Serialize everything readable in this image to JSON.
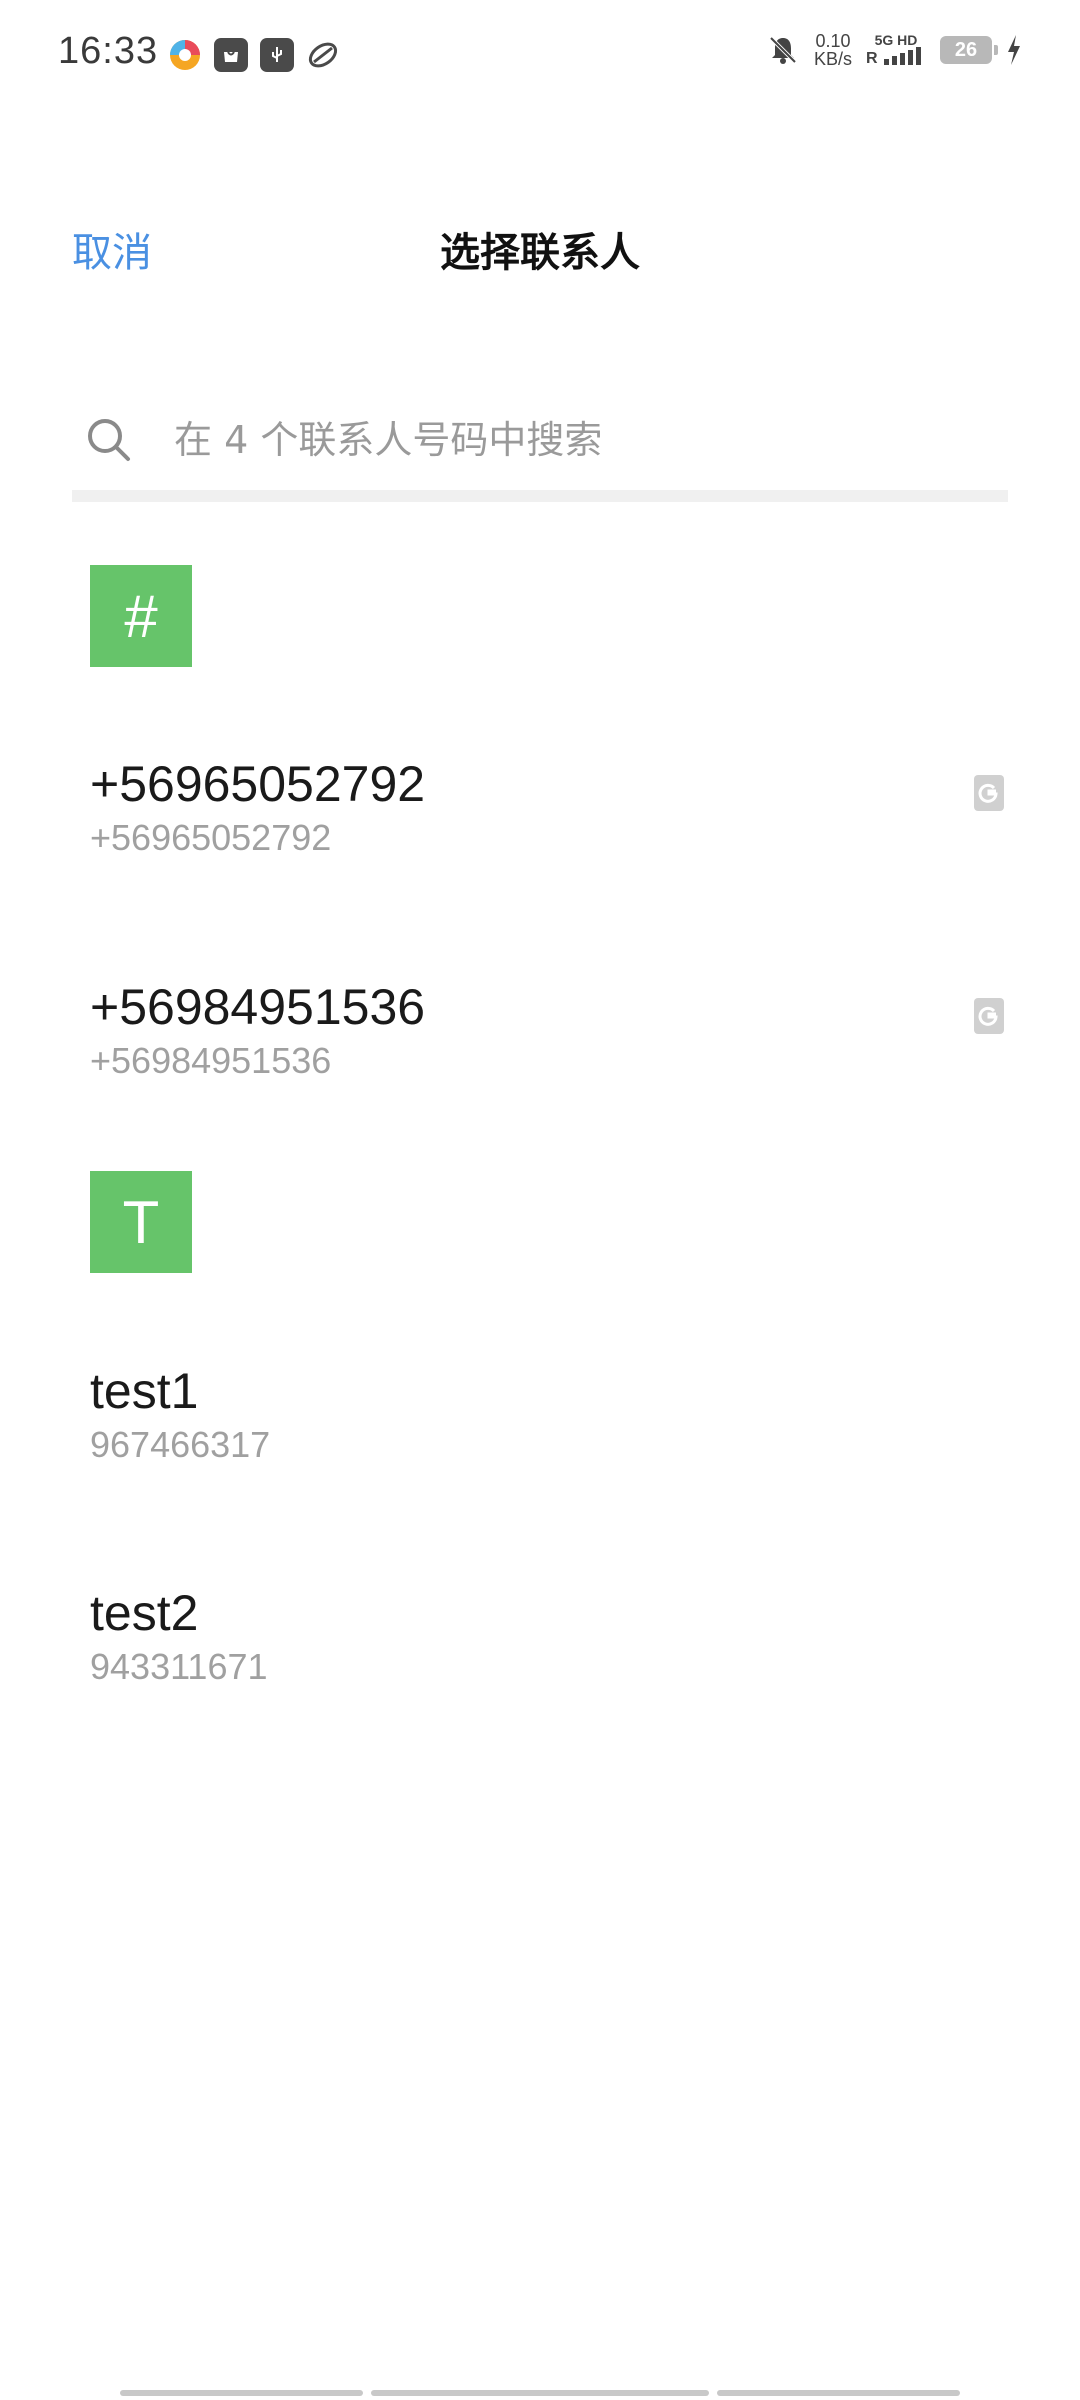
{
  "status_bar": {
    "time": "16:33",
    "net_speed_value": "0.10",
    "net_speed_unit": "KB/s",
    "signal_label": "5G HD",
    "battery": "26"
  },
  "header": {
    "cancel_label": "取消",
    "title": "选择联系人"
  },
  "search": {
    "placeholder": "在 4 个联系人号码中搜索"
  },
  "sections": [
    {
      "letter": "#",
      "contacts": [
        {
          "name": "+56965052792",
          "number": "+56965052792",
          "icon": "google-contact-icon"
        },
        {
          "name": "+56984951536",
          "number": "+56984951536",
          "icon": "google-contact-icon"
        }
      ]
    },
    {
      "letter": "T",
      "contacts": [
        {
          "name": "test1",
          "number": "967466317"
        },
        {
          "name": "test2",
          "number": "943311671"
        }
      ]
    }
  ],
  "colors": {
    "accent": "#4a90e2",
    "section_badge": "#66c46a",
    "secondary_text": "#a0a0a0"
  }
}
